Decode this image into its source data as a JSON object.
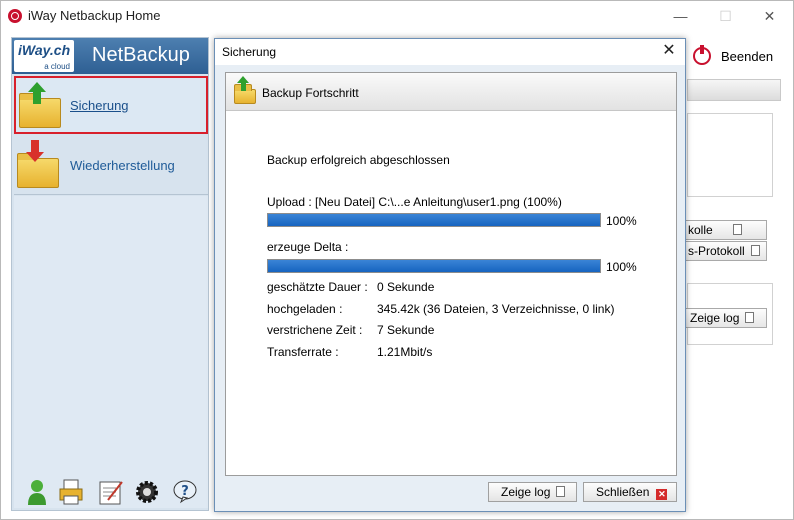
{
  "window": {
    "title": "iWay Netbackup Home",
    "minimize": "—",
    "maximize": "☐",
    "close": "✕"
  },
  "brand": {
    "logo_main": "iWay.ch",
    "logo_sub": "a cloud",
    "product": "NetBackup"
  },
  "sidebar": {
    "items": [
      {
        "label": "Sicherung",
        "icon": "folder-upload-icon",
        "active": true
      },
      {
        "label": "Wiederherstellung",
        "icon": "folder-download-icon",
        "active": false
      }
    ],
    "bottom_icons": [
      "user-icon",
      "printer-icon",
      "log-editor-icon",
      "settings-gear-icon",
      "help-icon"
    ]
  },
  "toolbar": {
    "exit_label": "Beenden"
  },
  "background_panel": {
    "btn_protocols": "kolle",
    "btn_transfer_protocol": "s-Protokoll",
    "btn_show_log": "Zeige log"
  },
  "dialog": {
    "title": "Sicherung",
    "close": "✕",
    "header": "Backup Fortschritt",
    "status": "Backup erfolgreich abgeschlossen",
    "upload": {
      "label": "Upload :  [Neu Datei] C:\\...e Anleitung\\user1.png (100%)",
      "progress": 100,
      "percent_text": "100%"
    },
    "delta": {
      "label": "erzeuge Delta :",
      "progress": 100,
      "percent_text": "100%"
    },
    "stats": [
      {
        "label": "geschätzte Dauer :",
        "value": "0 Sekunde"
      },
      {
        "label": "hochgeladen :",
        "value": "345.42k (36 Dateien, 3 Verzeichnisse, 0 link)"
      },
      {
        "label": "verstrichene  Zeit :",
        "value": "7 Sekunde"
      },
      {
        "label": "Transferrate :",
        "value": "1.21Mbit/s"
      }
    ],
    "buttons": {
      "show_log": "Zeige log",
      "close": "Schließen"
    }
  },
  "colors": {
    "accent_red": "#d8202c",
    "progress_blue": "#1664c0",
    "brand_blue": "#2e5f93"
  }
}
